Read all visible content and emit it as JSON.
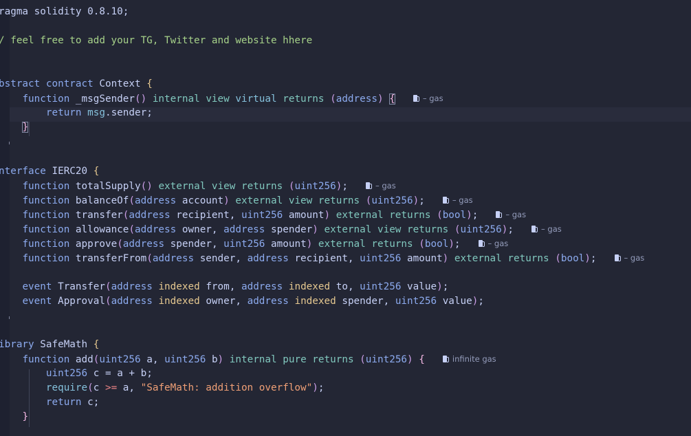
{
  "editor": {
    "lines": [
      [
        [
          "pragma",
          "ragma"
        ],
        [
          "pragma",
          " solidity "
        ],
        [
          "pragma",
          "0.8.10"
        ],
        [
          "pn",
          ";"
        ]
      ],
      [],
      [
        [
          "com",
          "/ feel free to add your TG, Twitter and website hhere"
        ]
      ],
      [],
      [],
      [
        [
          "kw",
          "bstract"
        ],
        [
          "pn",
          " "
        ],
        [
          "kw",
          "contract"
        ],
        [
          "pn",
          " "
        ],
        [
          "id",
          "Context"
        ],
        [
          "pn",
          " "
        ],
        [
          "brace",
          "{"
        ]
      ],
      [
        [
          "pn",
          "    "
        ],
        [
          "kw",
          "function"
        ],
        [
          "pn",
          " "
        ],
        [
          "fn",
          "_msgSender"
        ],
        [
          "paren",
          "()"
        ],
        [
          "pn",
          " "
        ],
        [
          "vis",
          "internal"
        ],
        [
          "pn",
          " "
        ],
        [
          "vis",
          "view"
        ],
        [
          "pn",
          " "
        ],
        [
          "virt",
          "virtual"
        ],
        [
          "pn",
          " "
        ],
        [
          "vis",
          "returns"
        ],
        [
          "pn",
          " "
        ],
        [
          "paren",
          "("
        ],
        [
          "kw",
          "address"
        ],
        [
          "paren",
          ")"
        ],
        [
          "pn",
          " "
        ],
        [
          "brace2box",
          "{"
        ],
        [
          "lens",
          "– gas"
        ]
      ],
      [
        [
          "pn",
          "        "
        ],
        [
          "kw",
          "return"
        ],
        [
          "pn",
          " "
        ],
        [
          "virt",
          "msg"
        ],
        [
          "pn",
          "."
        ],
        [
          "id",
          "sender"
        ],
        [
          "pn",
          ";"
        ]
      ],
      [
        [
          "pn",
          "    "
        ],
        [
          "brace2box",
          "}"
        ]
      ],
      [],
      [],
      [
        [
          "kw",
          "nterface"
        ],
        [
          "pn",
          " "
        ],
        [
          "id",
          "IERC20"
        ],
        [
          "pn",
          " "
        ],
        [
          "brace",
          "{"
        ]
      ],
      [
        [
          "pn",
          "    "
        ],
        [
          "kw",
          "function"
        ],
        [
          "pn",
          " "
        ],
        [
          "fn",
          "totalSupply"
        ],
        [
          "paren",
          "()"
        ],
        [
          "pn",
          " "
        ],
        [
          "vis",
          "external"
        ],
        [
          "pn",
          " "
        ],
        [
          "vis",
          "view"
        ],
        [
          "pn",
          " "
        ],
        [
          "vis",
          "returns"
        ],
        [
          "pn",
          " "
        ],
        [
          "paren",
          "("
        ],
        [
          "kw",
          "uint256"
        ],
        [
          "paren",
          ")"
        ],
        [
          "pn",
          ";"
        ],
        [
          "lens",
          "– gas"
        ]
      ],
      [
        [
          "pn",
          "    "
        ],
        [
          "kw",
          "function"
        ],
        [
          "pn",
          " "
        ],
        [
          "fn",
          "balanceOf"
        ],
        [
          "paren",
          "("
        ],
        [
          "kw",
          "address"
        ],
        [
          "pn",
          " "
        ],
        [
          "id",
          "account"
        ],
        [
          "paren",
          ")"
        ],
        [
          "pn",
          " "
        ],
        [
          "vis",
          "external"
        ],
        [
          "pn",
          " "
        ],
        [
          "vis",
          "view"
        ],
        [
          "pn",
          " "
        ],
        [
          "vis",
          "returns"
        ],
        [
          "pn",
          " "
        ],
        [
          "paren",
          "("
        ],
        [
          "kw",
          "uint256"
        ],
        [
          "paren",
          ")"
        ],
        [
          "pn",
          ";"
        ],
        [
          "lens",
          "– gas"
        ]
      ],
      [
        [
          "pn",
          "    "
        ],
        [
          "kw",
          "function"
        ],
        [
          "pn",
          " "
        ],
        [
          "fn",
          "transfer"
        ],
        [
          "paren",
          "("
        ],
        [
          "kw",
          "address"
        ],
        [
          "pn",
          " "
        ],
        [
          "id",
          "recipient"
        ],
        [
          "pn",
          ", "
        ],
        [
          "kw",
          "uint256"
        ],
        [
          "pn",
          " "
        ],
        [
          "id",
          "amount"
        ],
        [
          "paren",
          ")"
        ],
        [
          "pn",
          " "
        ],
        [
          "vis",
          "external"
        ],
        [
          "pn",
          " "
        ],
        [
          "vis",
          "returns"
        ],
        [
          "pn",
          " "
        ],
        [
          "paren",
          "("
        ],
        [
          "kw",
          "bool"
        ],
        [
          "paren",
          ")"
        ],
        [
          "pn",
          ";"
        ],
        [
          "lens",
          "– gas"
        ]
      ],
      [
        [
          "pn",
          "    "
        ],
        [
          "kw",
          "function"
        ],
        [
          "pn",
          " "
        ],
        [
          "fn",
          "allowance"
        ],
        [
          "paren",
          "("
        ],
        [
          "kw",
          "address"
        ],
        [
          "pn",
          " "
        ],
        [
          "id",
          "owner"
        ],
        [
          "pn",
          ", "
        ],
        [
          "kw",
          "address"
        ],
        [
          "pn",
          " "
        ],
        [
          "id",
          "spender"
        ],
        [
          "paren",
          ")"
        ],
        [
          "pn",
          " "
        ],
        [
          "vis",
          "external"
        ],
        [
          "pn",
          " "
        ],
        [
          "vis",
          "view"
        ],
        [
          "pn",
          " "
        ],
        [
          "vis",
          "returns"
        ],
        [
          "pn",
          " "
        ],
        [
          "paren",
          "("
        ],
        [
          "kw",
          "uint256"
        ],
        [
          "paren",
          ")"
        ],
        [
          "pn",
          ";"
        ],
        [
          "lens",
          "– gas"
        ]
      ],
      [
        [
          "pn",
          "    "
        ],
        [
          "kw",
          "function"
        ],
        [
          "pn",
          " "
        ],
        [
          "fn",
          "approve"
        ],
        [
          "paren",
          "("
        ],
        [
          "kw",
          "address"
        ],
        [
          "pn",
          " "
        ],
        [
          "id",
          "spender"
        ],
        [
          "pn",
          ", "
        ],
        [
          "kw",
          "uint256"
        ],
        [
          "pn",
          " "
        ],
        [
          "id",
          "amount"
        ],
        [
          "paren",
          ")"
        ],
        [
          "pn",
          " "
        ],
        [
          "vis",
          "external"
        ],
        [
          "pn",
          " "
        ],
        [
          "vis",
          "returns"
        ],
        [
          "pn",
          " "
        ],
        [
          "paren",
          "("
        ],
        [
          "kw",
          "bool"
        ],
        [
          "paren",
          ")"
        ],
        [
          "pn",
          ";"
        ],
        [
          "lens",
          "– gas"
        ]
      ],
      [
        [
          "pn",
          "    "
        ],
        [
          "kw",
          "function"
        ],
        [
          "pn",
          " "
        ],
        [
          "fn",
          "transferFrom"
        ],
        [
          "paren",
          "("
        ],
        [
          "kw",
          "address"
        ],
        [
          "pn",
          " "
        ],
        [
          "id",
          "sender"
        ],
        [
          "pn",
          ", "
        ],
        [
          "kw",
          "address"
        ],
        [
          "pn",
          " "
        ],
        [
          "id",
          "recipient"
        ],
        [
          "pn",
          ", "
        ],
        [
          "kw",
          "uint256"
        ],
        [
          "pn",
          " "
        ],
        [
          "id",
          "amount"
        ],
        [
          "paren",
          ")"
        ],
        [
          "pn",
          " "
        ],
        [
          "vis",
          "external"
        ],
        [
          "pn",
          " "
        ],
        [
          "vis",
          "returns"
        ],
        [
          "pn",
          " "
        ],
        [
          "paren",
          "("
        ],
        [
          "kw",
          "bool"
        ],
        [
          "paren",
          ")"
        ],
        [
          "pn",
          ";"
        ],
        [
          "lens",
          "– gas"
        ]
      ],
      [],
      [
        [
          "pn",
          "    "
        ],
        [
          "kw",
          "event"
        ],
        [
          "pn",
          " "
        ],
        [
          "fn",
          "Transfer"
        ],
        [
          "paren",
          "("
        ],
        [
          "kw",
          "address"
        ],
        [
          "pn",
          " "
        ],
        [
          "flag",
          "indexed"
        ],
        [
          "pn",
          " "
        ],
        [
          "id",
          "from"
        ],
        [
          "pn",
          ", "
        ],
        [
          "kw",
          "address"
        ],
        [
          "pn",
          " "
        ],
        [
          "flag",
          "indexed"
        ],
        [
          "pn",
          " "
        ],
        [
          "id",
          "to"
        ],
        [
          "pn",
          ", "
        ],
        [
          "kw",
          "uint256"
        ],
        [
          "pn",
          " "
        ],
        [
          "id",
          "value"
        ],
        [
          "paren",
          ")"
        ],
        [
          "pn",
          ";"
        ]
      ],
      [
        [
          "pn",
          "    "
        ],
        [
          "kw",
          "event"
        ],
        [
          "pn",
          " "
        ],
        [
          "fn",
          "Approval"
        ],
        [
          "paren",
          "("
        ],
        [
          "kw",
          "address"
        ],
        [
          "pn",
          " "
        ],
        [
          "flag",
          "indexed"
        ],
        [
          "pn",
          " "
        ],
        [
          "id",
          "owner"
        ],
        [
          "pn",
          ", "
        ],
        [
          "kw",
          "address"
        ],
        [
          "pn",
          " "
        ],
        [
          "flag",
          "indexed"
        ],
        [
          "pn",
          " "
        ],
        [
          "id",
          "spender"
        ],
        [
          "pn",
          ", "
        ],
        [
          "kw",
          "uint256"
        ],
        [
          "pn",
          " "
        ],
        [
          "id",
          "value"
        ],
        [
          "paren",
          ")"
        ],
        [
          "pn",
          ";"
        ]
      ],
      [],
      [],
      [
        [
          "kw",
          "ibrary"
        ],
        [
          "pn",
          " "
        ],
        [
          "id",
          "SafeMath"
        ],
        [
          "pn",
          " "
        ],
        [
          "brace",
          "{"
        ]
      ],
      [
        [
          "pn",
          "    "
        ],
        [
          "kw",
          "function"
        ],
        [
          "pn",
          " "
        ],
        [
          "fn",
          "add"
        ],
        [
          "paren",
          "("
        ],
        [
          "kw",
          "uint256"
        ],
        [
          "pn",
          " "
        ],
        [
          "id",
          "a"
        ],
        [
          "pn",
          ", "
        ],
        [
          "kw",
          "uint256"
        ],
        [
          "pn",
          " "
        ],
        [
          "id",
          "b"
        ],
        [
          "paren",
          ")"
        ],
        [
          "pn",
          " "
        ],
        [
          "vis",
          "internal"
        ],
        [
          "pn",
          " "
        ],
        [
          "vis",
          "pure"
        ],
        [
          "pn",
          " "
        ],
        [
          "vis",
          "returns"
        ],
        [
          "pn",
          " "
        ],
        [
          "paren",
          "("
        ],
        [
          "kw",
          "uint256"
        ],
        [
          "paren",
          ")"
        ],
        [
          "pn",
          " "
        ],
        [
          "brace2",
          "{"
        ],
        [
          "lens",
          "infinite gas"
        ]
      ],
      [
        [
          "pn",
          "        "
        ],
        [
          "kw",
          "uint256"
        ],
        [
          "pn",
          " "
        ],
        [
          "id",
          "c"
        ],
        [
          "pn",
          " = "
        ],
        [
          "id",
          "a"
        ],
        [
          "pn",
          " + "
        ],
        [
          "id",
          "b"
        ],
        [
          "pn",
          ";"
        ]
      ],
      [
        [
          "pn",
          "        "
        ],
        [
          "virt",
          "require"
        ],
        [
          "paren",
          "("
        ],
        [
          "id",
          "c"
        ],
        [
          "pn",
          " "
        ],
        [
          "op",
          ">="
        ],
        [
          "pn",
          " "
        ],
        [
          "id",
          "a"
        ],
        [
          "pn",
          ", "
        ],
        [
          "str",
          "\"SafeMath: addition overflow\""
        ],
        [
          "paren",
          ")"
        ],
        [
          "pn",
          ";"
        ]
      ],
      [
        [
          "pn",
          "        "
        ],
        [
          "kw",
          "return"
        ],
        [
          "pn",
          " "
        ],
        [
          "id",
          "c"
        ],
        [
          "pn",
          ";"
        ]
      ],
      [
        [
          "pn",
          "    "
        ],
        [
          "brace2",
          "}"
        ]
      ]
    ],
    "theme": {
      "background": "#232634",
      "keyword": "#8caaee",
      "modifier": "#81c8be",
      "paren": "#ca9ee6",
      "brace": "#e5c890",
      "string": "#ef9f76",
      "comment": "#a6d189"
    },
    "codelens_icon": "gas-pump-icon"
  }
}
